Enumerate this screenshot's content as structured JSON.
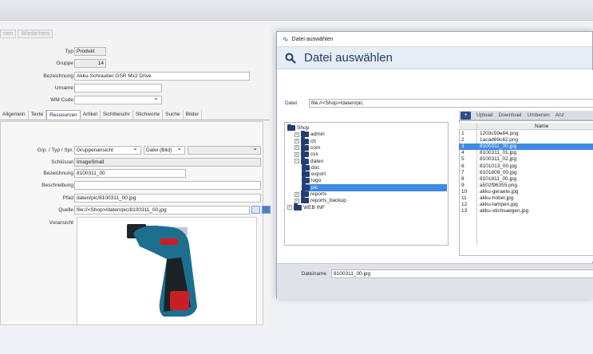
{
  "top_buttons": [
    "rren",
    "Wiederhers"
  ],
  "product": {
    "typ_label": "Typ",
    "typ_value": "Produkt",
    "gruppe_label": "Gruppe",
    "gruppe_value": "14",
    "bez_label": "Bezeichnung",
    "bez_value": "Akku-Schrauber GSR Mx2 Drive",
    "urname_label": "Urname",
    "urname_value": "",
    "wm_label": "WM Code",
    "wm_value": ""
  },
  "tabs": [
    "Allgemein",
    "Texte",
    "Ressourcen",
    "Artikel",
    "Sichtbeschr",
    "Stichworte",
    "Suche",
    "Bilder"
  ],
  "resource": {
    "grp_label": "Grp. / Typ / Spr.",
    "grp_value": "Gruppenansicht",
    "typ_value": "Datei (Bild)",
    "spr_value": "",
    "schluessel_label": "Schlüssel",
    "schluessel_value": "ImageSmall",
    "bez_label": "Bezeichnung",
    "bez_value": "8100311_00",
    "beschreibung_label": "Beschreibung",
    "beschreibung_value": "",
    "pfad_label": "Pfad",
    "pfad_value": "daten/pic/8100311_00.jpg",
    "quelle_label": "Quelle",
    "quelle_value": "file://<Shop>/daten/pic/8100311_00.jpg",
    "voransicht_label": "Voransicht"
  },
  "dialog": {
    "title": "Datei auswählen",
    "header": "Datei auswählen",
    "path_label": "Datei",
    "path_value": "file://<Shop>/daten/pic",
    "toolbar": [
      "Upload",
      "Download",
      "Umbenen",
      "Anz"
    ],
    "col_name": "Name",
    "tree": [
      {
        "label": "Shop",
        "level": 0,
        "exp": ""
      },
      {
        "label": "admin",
        "level": 1,
        "exp": "+"
      },
      {
        "label": "ch",
        "level": 1,
        "exp": "+"
      },
      {
        "label": "com",
        "level": 1,
        "exp": "+"
      },
      {
        "label": "css",
        "level": 1,
        "exp": "+"
      },
      {
        "label": "daten",
        "level": 1,
        "exp": "−"
      },
      {
        "label": "doc",
        "level": 2,
        "exp": ""
      },
      {
        "label": "export",
        "level": 2,
        "exp": ""
      },
      {
        "label": "logo",
        "level": 2,
        "exp": ""
      },
      {
        "label": "pic",
        "level": 2,
        "exp": "",
        "selected": true
      },
      {
        "label": "reports",
        "level": 1,
        "exp": "+"
      },
      {
        "label": "reports_backup",
        "level": 1,
        "exp": "+"
      },
      {
        "label": "WEB INF",
        "level": 0,
        "exp": "+"
      }
    ],
    "files": [
      {
        "n": "1",
        "f": "1203c59e84.png"
      },
      {
        "n": "2",
        "f": "1acad69c42.png"
      },
      {
        "n": "3",
        "f": "8100311_00.jpg",
        "selected": true
      },
      {
        "n": "4",
        "f": "8100311_01.jpg"
      },
      {
        "n": "5",
        "f": "8100311_02.jpg"
      },
      {
        "n": "6",
        "f": "8101013_00.jpg"
      },
      {
        "n": "7",
        "f": "8101809_00.jpg"
      },
      {
        "n": "8",
        "f": "8101811_00.jpg"
      },
      {
        "n": "9",
        "f": "a502f96355.png"
      },
      {
        "n": "10",
        "f": "akku-geraete.jpg"
      },
      {
        "n": "11",
        "f": "akku-hobel.jpg"
      },
      {
        "n": "12",
        "f": "akku-lampen.jpg"
      },
      {
        "n": "13",
        "f": "akku-stichsaegen.jpg"
      }
    ],
    "filename_label": "Dateiname",
    "filename_value": "8100311_00.jpg"
  },
  "colors": {
    "accent": "#3d8ae4",
    "folder": "#243e72",
    "header": "#1f3c6c"
  }
}
